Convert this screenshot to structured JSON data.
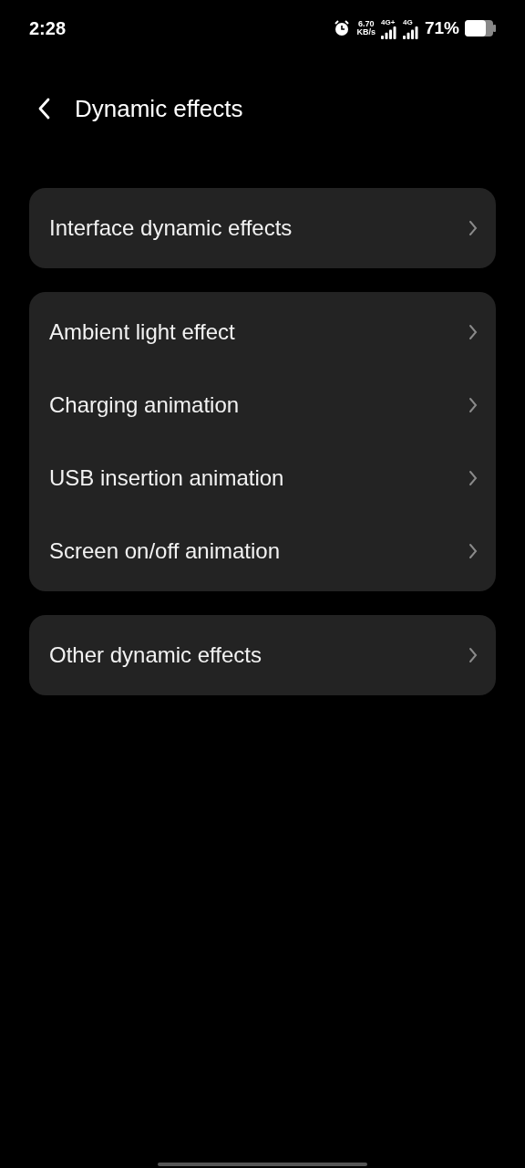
{
  "status_bar": {
    "time": "2:28",
    "speed_value": "6.70",
    "speed_unit": "KB/s",
    "sim1_type": "4G+",
    "sim2_type": "4G",
    "battery": "71%"
  },
  "header": {
    "title": "Dynamic effects"
  },
  "groups": [
    {
      "items": [
        {
          "label": "Interface dynamic effects"
        }
      ]
    },
    {
      "items": [
        {
          "label": "Ambient light effect"
        },
        {
          "label": "Charging animation"
        },
        {
          "label": "USB insertion animation"
        },
        {
          "label": "Screen on/off animation"
        }
      ]
    },
    {
      "items": [
        {
          "label": "Other dynamic effects"
        }
      ]
    }
  ]
}
